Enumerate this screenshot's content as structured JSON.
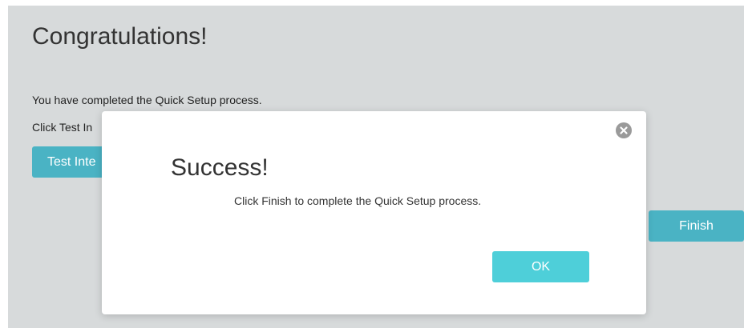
{
  "page": {
    "title": "Congratulations!",
    "completed_text": "You have completed the Quick Setup process.",
    "test_instruction_partial": "Click Test In",
    "test_button_partial": "Test Inte",
    "finish_label": "Finish"
  },
  "modal": {
    "title": "Success!",
    "message": "Click Finish to complete the Quick Setup process.",
    "ok_label": "OK",
    "close_icon": "close-circle-icon"
  },
  "colors": {
    "background_panel": "#d7dadb",
    "primary_button": "#4ab3c4",
    "ok_button": "#4ecfd9",
    "close_icon": "#9a9a9a"
  }
}
